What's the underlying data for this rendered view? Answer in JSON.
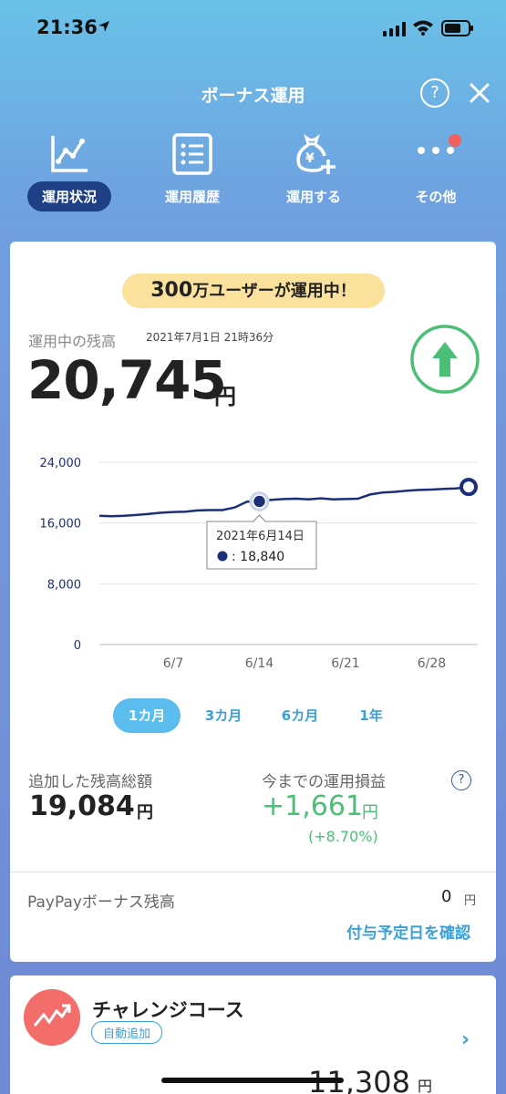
{
  "status": {
    "time": "21:36"
  },
  "header": {
    "title": "ボーナス運用",
    "help": "?"
  },
  "nav": [
    {
      "label": "運用状況",
      "icon": "chart-line-icon",
      "active": true
    },
    {
      "label": "運用履歴",
      "icon": "list-icon",
      "active": false
    },
    {
      "label": "運用する",
      "icon": "money-bag-add-icon",
      "active": false
    },
    {
      "label": "その他",
      "icon": "more-dots-icon",
      "active": false
    }
  ],
  "banner": {
    "count": "300",
    "suffix": "万ユーザーが運用中！"
  },
  "balance": {
    "label": "運用中の残高",
    "date": "2021年7月1日 21時36分",
    "amount": "20,745",
    "unit": "円"
  },
  "chart_data": {
    "type": "line",
    "yticks": [
      "24,000",
      "16,000",
      "8,000",
      "0"
    ],
    "xticks": [
      "6/7",
      "6/14",
      "6/21",
      "6/28"
    ],
    "ylim": [
      0,
      24000
    ],
    "x": [
      "6/1",
      "6/2",
      "6/3",
      "6/4",
      "6/5",
      "6/6",
      "6/7",
      "6/8",
      "6/9",
      "6/10",
      "6/11",
      "6/12",
      "6/13",
      "6/14",
      "6/15",
      "6/16",
      "6/17",
      "6/18",
      "6/19",
      "6/20",
      "6/21",
      "6/22",
      "6/23",
      "6/24",
      "6/25",
      "6/26",
      "6/27",
      "6/28",
      "6/29",
      "6/30",
      "7/1"
    ],
    "values": [
      16950,
      16900,
      16950,
      17050,
      17200,
      17350,
      17450,
      17500,
      17650,
      17700,
      17700,
      18050,
      18800,
      18840,
      19050,
      19150,
      19200,
      19100,
      19250,
      19100,
      19150,
      19200,
      19750,
      20000,
      20100,
      20250,
      20350,
      20400,
      20500,
      20550,
      20745
    ],
    "tooltip": {
      "date": "2021年6月14日",
      "value": ": 18,840"
    },
    "color": "#1b2f78"
  },
  "ranges": [
    {
      "label": "1カ月",
      "active": true
    },
    {
      "label": "3カ月",
      "active": false
    },
    {
      "label": "6カ月",
      "active": false
    },
    {
      "label": "1年",
      "active": false
    }
  ],
  "stats": {
    "added_label": "追加した残高総額",
    "added_amount": "19,084",
    "pl_label": "今までの運用損益",
    "pl_amount": "+1,661",
    "pl_pct": "(+8.70%)",
    "unit": "円",
    "help": "?"
  },
  "bonus": {
    "label": "PayPayボーナス残高",
    "value": "0",
    "unit": "円",
    "link": "付与予定日を確認"
  },
  "course": {
    "title": "チャレンジコース",
    "tag": "自動追加",
    "amount": "11,308",
    "unit": "円",
    "chevron": "›"
  },
  "colors": {
    "accent": "#3aa0d8",
    "green": "#4cbf77",
    "navy": "#1f3f86",
    "banner": "#fbe29c"
  }
}
